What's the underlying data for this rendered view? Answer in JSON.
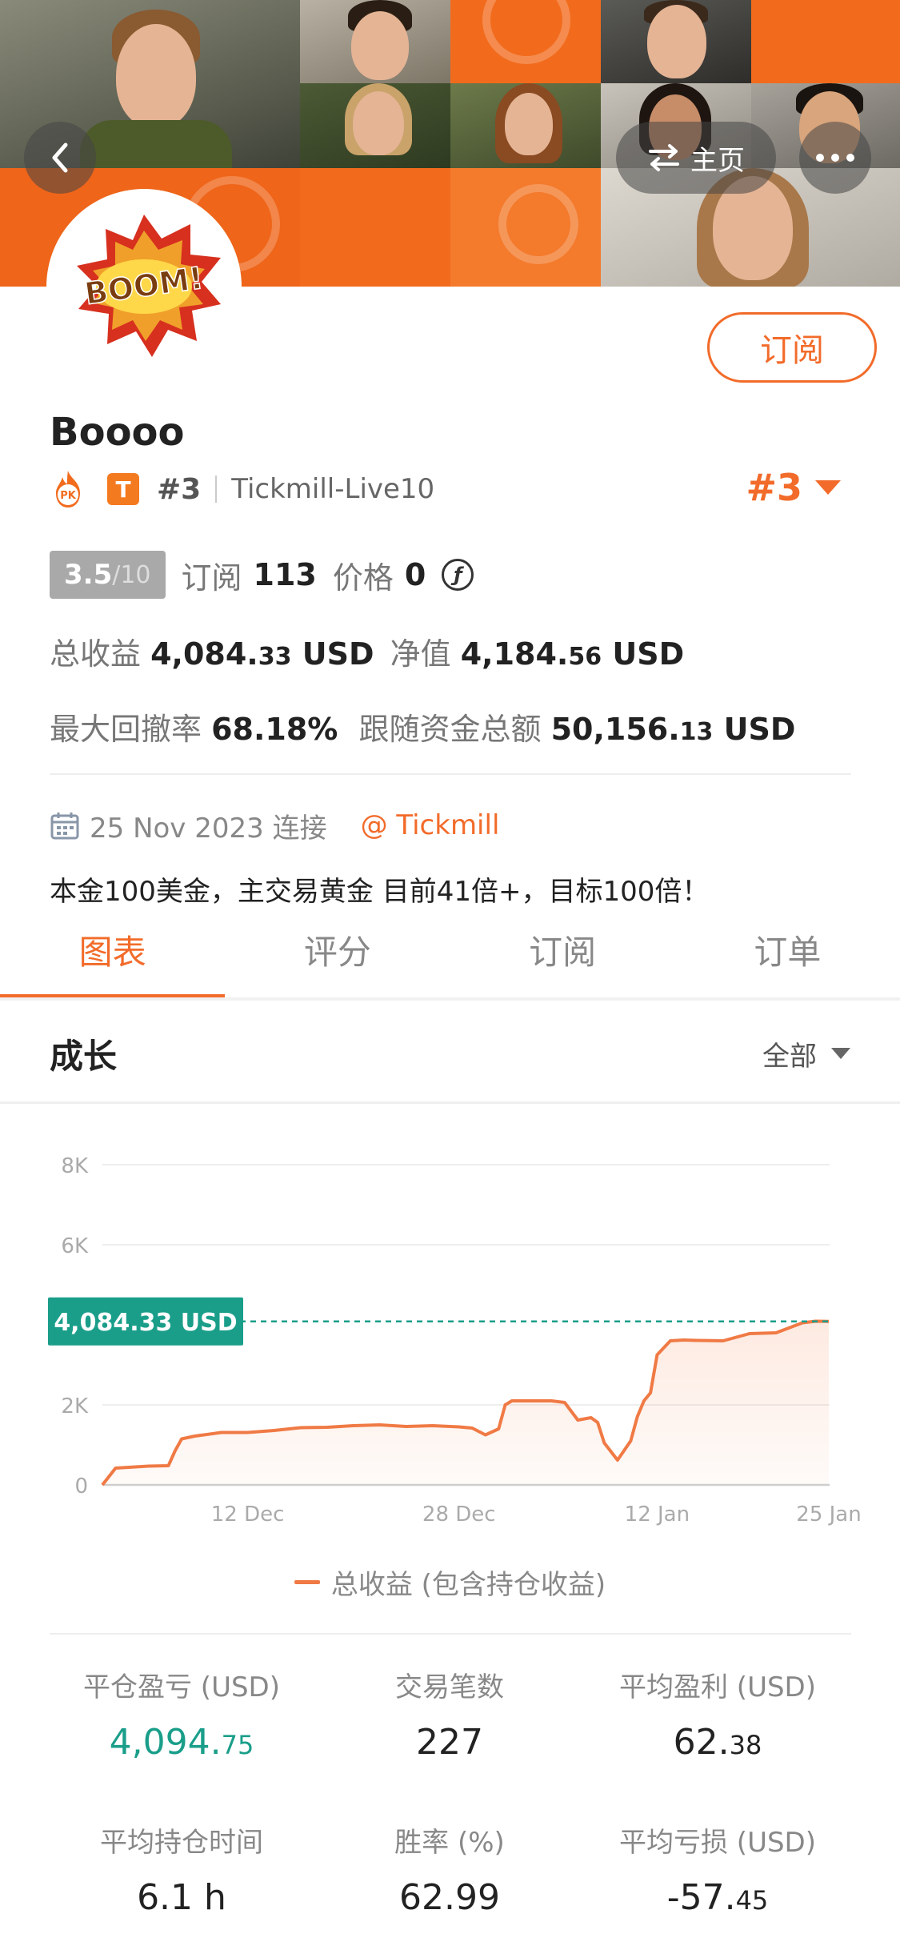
{
  "nav": {
    "home_label": "主页"
  },
  "profile": {
    "name": "Boooo",
    "avatar_text": "BOOM!",
    "pk_label": "PK",
    "badge_letter": "T",
    "rank_small": "#3",
    "account": "Tickmill-Live10",
    "rank_big": "#3",
    "subscribe_label": "订阅"
  },
  "stats": {
    "score": "3.5",
    "score_den": "/10",
    "subs_label": "订阅",
    "subs_value": "113",
    "price_label": "价格",
    "price_value": "0",
    "total_label": "总收益",
    "total_int": "4,084.",
    "total_dec": "33",
    "total_unit": "USD",
    "net_label": "净值",
    "net_int": "4,184.",
    "net_dec": "56",
    "net_unit": "USD",
    "dd_label": "最大回撤率",
    "dd_value": "68.18%",
    "follow_label": "跟随资金总额",
    "follow_int": "50,156.",
    "follow_dec": "13",
    "follow_unit": "USD"
  },
  "connection": {
    "date_text": "25 Nov 2023 连接",
    "broker": "@ Tickmill"
  },
  "description": "本金100美金，主交易黄金 目前41倍+，目标100倍！",
  "tabs": [
    "图表",
    "评分",
    "订阅",
    "订单"
  ],
  "section": {
    "title": "成长",
    "filter": "全部"
  },
  "chart_data": {
    "type": "area",
    "x_tick_labels": [
      "12 Dec",
      "28 Dec",
      "12 Jan",
      "25 Jan"
    ],
    "x_tick_days": [
      12,
      28,
      43,
      56
    ],
    "y_tick_labels": [
      "0",
      "2K",
      "6K",
      "8K"
    ],
    "y_tick_values": [
      0,
      2000,
      6000,
      8000
    ],
    "ylim": [
      0,
      8000
    ],
    "current_label": "4,084.33 USD",
    "current_value": 4084.33,
    "series": [
      {
        "name": "总收益 (包含持仓收益)",
        "x": [
          1,
          2,
          3,
          4.5,
          6,
          6.5,
          7,
          8,
          10,
          12,
          14,
          16,
          18,
          20,
          22,
          24,
          26,
          28,
          29,
          30,
          31,
          31.5,
          32,
          33,
          34,
          35,
          36,
          37,
          38,
          38.5,
          39,
          40,
          41,
          41.5,
          42,
          42.5,
          43,
          44,
          45,
          46,
          48,
          50,
          52,
          54,
          55,
          56
        ],
        "y": [
          0,
          420,
          440,
          470,
          480,
          850,
          1150,
          1220,
          1310,
          1310,
          1360,
          1430,
          1440,
          1480,
          1500,
          1460,
          1480,
          1450,
          1420,
          1250,
          1400,
          2000,
          2100,
          2100,
          2100,
          2100,
          2060,
          1620,
          1680,
          1560,
          1050,
          620,
          1100,
          1700,
          2100,
          2300,
          3250,
          3600,
          3620,
          3610,
          3600,
          3780,
          3800,
          4050,
          4090,
          4084.33
        ]
      }
    ]
  },
  "legend_label": "总收益 (包含持仓收益)",
  "grid": {
    "closed_pl_label": "平仓盈亏 (USD)",
    "closed_pl_int": "4,094.",
    "closed_pl_dec": "75",
    "trades_label": "交易笔数",
    "trades_value": "227",
    "avg_profit_label": "平均盈利 (USD)",
    "avg_profit_int": "62.",
    "avg_profit_dec": "38",
    "avg_hold_label": "平均持仓时间",
    "avg_hold_value": "6.1 h",
    "win_rate_label": "胜率 (%)",
    "win_rate_value": "62.99",
    "avg_loss_label": "平均亏损 (USD)",
    "avg_loss_int": "-57.",
    "avg_loss_dec": "45"
  },
  "colors": {
    "accent": "#f26b2a",
    "profit_green": "#1a9e8a",
    "cover_orange": "#f26b1d"
  }
}
